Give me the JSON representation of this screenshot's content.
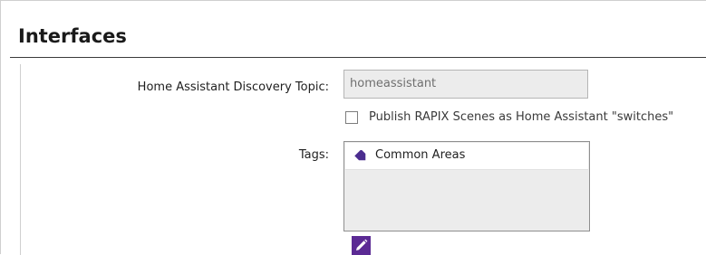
{
  "section": {
    "title": "Interfaces"
  },
  "form": {
    "discovery_topic": {
      "label": "Home Assistant Discovery Topic:",
      "value": "homeassistant"
    },
    "publish_scenes": {
      "label": "Publish RAPIX Scenes as Home Assistant \"switches\"",
      "checked": false
    },
    "tags": {
      "label": "Tags:",
      "items": [
        {
          "label": "Common Areas",
          "icon": "tag-icon",
          "color": "#4b2d8f"
        }
      ]
    },
    "edit_button": {
      "icon": "pencil-icon",
      "color": "#5b2a94"
    }
  }
}
